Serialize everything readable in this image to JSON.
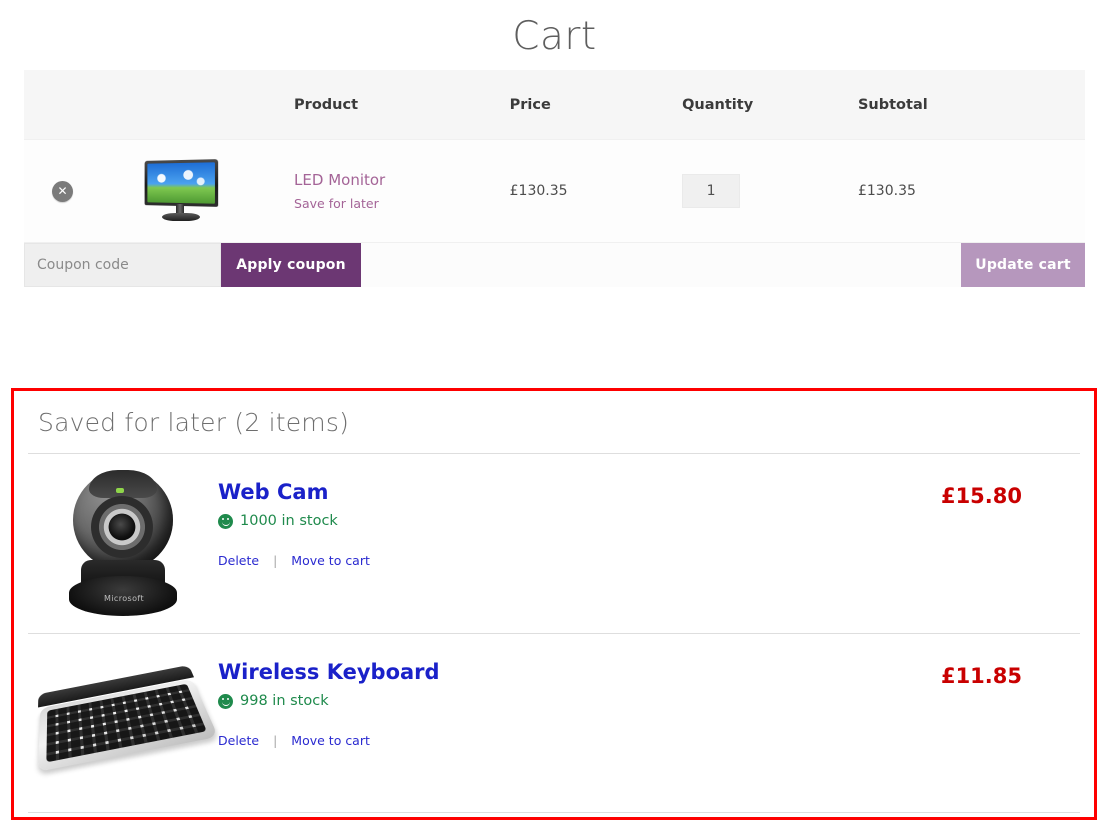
{
  "page": {
    "title": "Cart"
  },
  "cart_table": {
    "headers": [
      "",
      "",
      "Product",
      "Price",
      "Quantity",
      "Subtotal"
    ],
    "rows": [
      {
        "remove_label": "✕",
        "thumb_icon": "led-monitor-image",
        "product": "LED Monitor",
        "save_for_later": "Save for later",
        "price": "£130.35",
        "quantity": "1",
        "subtotal": "£130.35"
      }
    ]
  },
  "coupon": {
    "placeholder": "Coupon code",
    "value": "",
    "apply_label": "Apply coupon",
    "update_label": "Update cart"
  },
  "saved_for_later": {
    "heading": "Saved for later (2 items)",
    "items": [
      {
        "thumb_icon": "webcam-image",
        "brand_text": "Microsoft",
        "title": "Web Cam",
        "stock_icon": "smiley-face-icon",
        "stock": "1000 in stock",
        "delete_label": "Delete",
        "separator": "|",
        "move_label": "Move to cart",
        "price": "£15.80"
      },
      {
        "thumb_icon": "wireless-keyboard-image",
        "brand_text": "",
        "title": "Wireless Keyboard",
        "stock_icon": "smiley-face-icon",
        "stock": "998 in stock",
        "delete_label": "Delete",
        "separator": "|",
        "move_label": "Move to cart",
        "price": "£11.85"
      }
    ]
  },
  "colors": {
    "highlight_border": "#fe0000",
    "brand_purple": "#6c3773",
    "product_link": "#a46497",
    "saved_title": "#1a21c9",
    "price_red": "#c90000",
    "stock_green": "#1f8a4c"
  }
}
